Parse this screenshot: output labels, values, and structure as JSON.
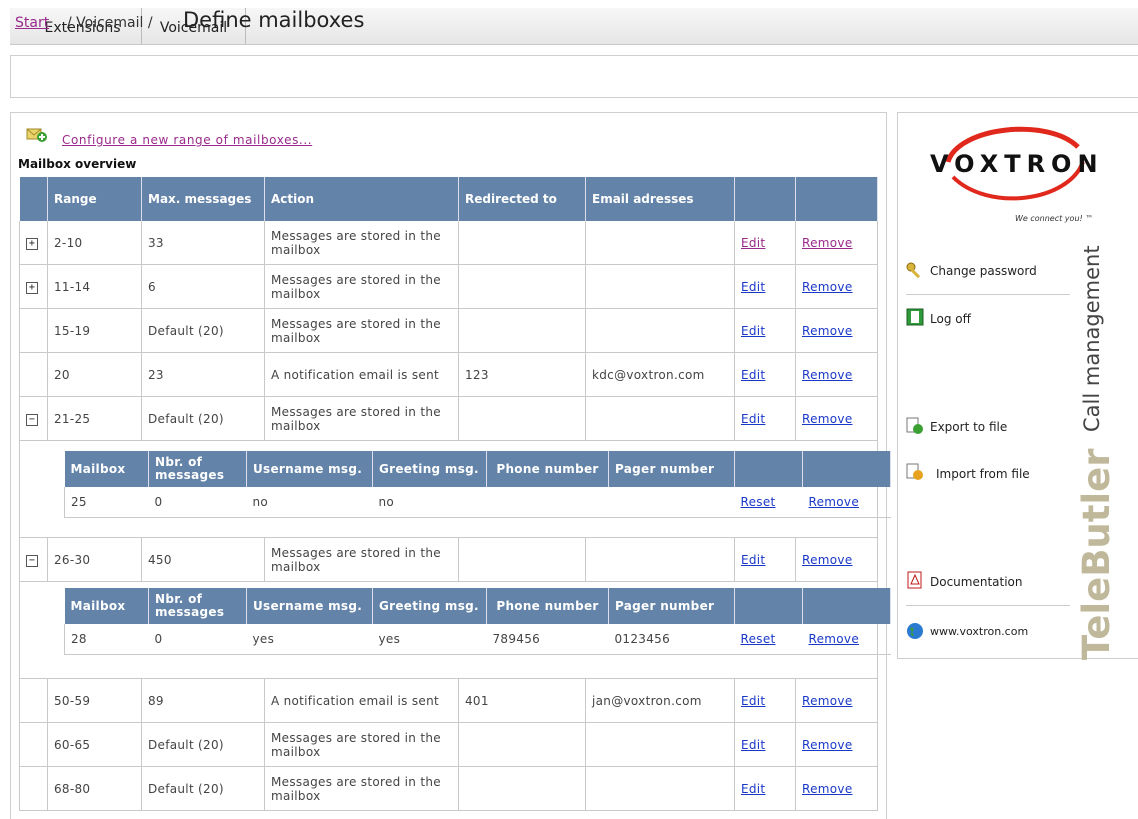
{
  "tabs": [
    {
      "label": "Extensions"
    },
    {
      "label": "Voicemail"
    }
  ],
  "breadcrumb": {
    "start": "Start",
    "separator1": "/ Voicemail /",
    "title": "Define mailboxes"
  },
  "configure_link": "Configure a new range of mailboxes...",
  "overview_title": "Mailbox overview",
  "table": {
    "headers": [
      "Range",
      "Max. messages",
      "Action",
      "Redirected to",
      "Email adresses"
    ],
    "edit_label": "Edit",
    "remove_label": "Remove",
    "rows": [
      {
        "range": "2-10",
        "max": "33",
        "action": "Messages are stored in the mailbox",
        "redirect": "",
        "email": "",
        "expander": "+"
      },
      {
        "range": "11-14",
        "max": "6",
        "action": "Messages are stored in the mailbox",
        "redirect": "",
        "email": "",
        "expander": "+"
      },
      {
        "range": "15-19",
        "max": "Default (20)",
        "action": "Messages are stored in the mailbox",
        "redirect": "",
        "email": "",
        "expander": ""
      },
      {
        "range": "20",
        "max": "23",
        "action": "A notification email is sent",
        "redirect": "123",
        "email": "kdc@voxtron.com",
        "expander": ""
      },
      {
        "range": "21-25",
        "max": "Default (20)",
        "action": "Messages are stored in the mailbox",
        "redirect": "",
        "email": "",
        "expander": "−"
      },
      {
        "range": "26-30",
        "max": "450",
        "action": "Messages are stored in the mailbox",
        "redirect": "",
        "email": "",
        "expander": "−"
      },
      {
        "range": "50-59",
        "max": "89",
        "action": "A notification email is sent",
        "redirect": "401",
        "email": "jan@voxtron.com",
        "expander": ""
      },
      {
        "range": "60-65",
        "max": "Default (20)",
        "action": "Messages are stored in the mailbox",
        "redirect": "",
        "email": "",
        "expander": ""
      },
      {
        "range": "68-80",
        "max": "Default (20)",
        "action": "Messages are stored in the mailbox",
        "redirect": "",
        "email": "",
        "expander": ""
      }
    ]
  },
  "subtable": {
    "headers": [
      "Mailbox",
      "Nbr. of messages",
      "Username msg.",
      "Greeting msg.",
      "Phone number",
      "Pager number"
    ],
    "reset_label": "Reset",
    "remove_label": "Remove",
    "sub1": {
      "mailbox": "25",
      "count": "0",
      "username": "no",
      "greeting": "no",
      "phone": "",
      "pager": ""
    },
    "sub2": {
      "mailbox": "28",
      "count": "0",
      "username": "yes",
      "greeting": "yes",
      "phone": "789456",
      "pager": "0123456"
    }
  },
  "sidebar": {
    "logo": "VOXTRON",
    "tagline": "We connect you! ™",
    "change_password": "Change password",
    "log_off": "Log off",
    "export": "Export to file",
    "import": "Import from file",
    "documentation": "Documentation",
    "website": "www.voxtron.com",
    "brand_vertical": "TeleButler",
    "brand_sub": "Call management"
  },
  "colors": {
    "header_bg": "#6383a8",
    "link": "#1a38c8",
    "visited_link": "#9a2a8b",
    "brand_red": "#e0281c"
  }
}
